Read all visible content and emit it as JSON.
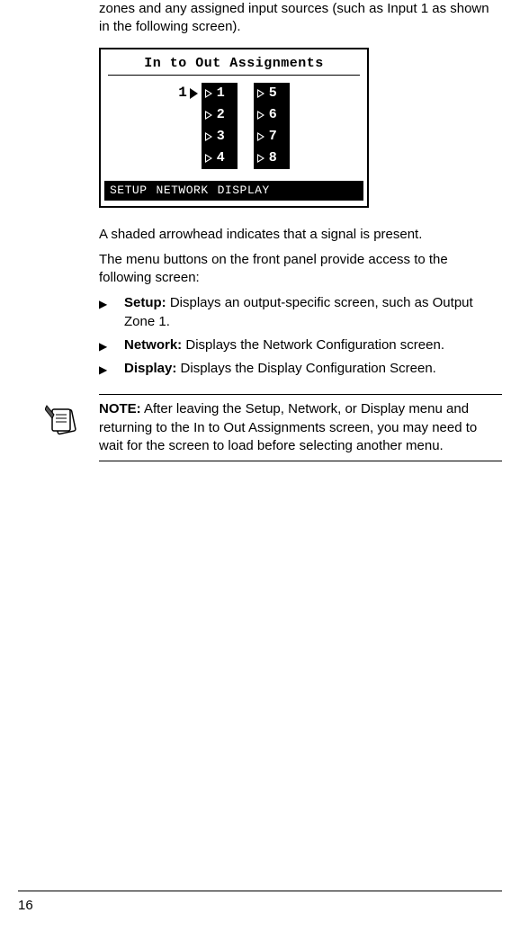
{
  "intro": "zones and any assigned input sources (such as Input 1 as shown in the following screen).",
  "screen": {
    "title": "In to Out Assignments",
    "prefix": "1",
    "left": [
      "1",
      "2",
      "3",
      "4"
    ],
    "right": [
      "5",
      "6",
      "7",
      "8"
    ],
    "footer": {
      "setup": "SETUP",
      "network": "NETWORK",
      "display": "DISPLAY"
    }
  },
  "shaded": "A shaded arrowhead indicates that a signal is present.",
  "menu_intro": "The menu buttons on the front panel provide access to the following screen:",
  "bullets": [
    {
      "label": "Setup:",
      "text": " Displays an output-specific screen, such as Output Zone 1."
    },
    {
      "label": "Network:",
      "text": " Displays the Network Configuration screen."
    },
    {
      "label": "Display:",
      "text": " Displays the Display Configuration Screen."
    }
  ],
  "note": {
    "label": "NOTE:",
    "text": "  After leaving the Setup, Network, or Display menu and returning to the In to Out Assignments screen, you may need to wait for the screen to load before selecting another menu."
  },
  "page_number": "16"
}
